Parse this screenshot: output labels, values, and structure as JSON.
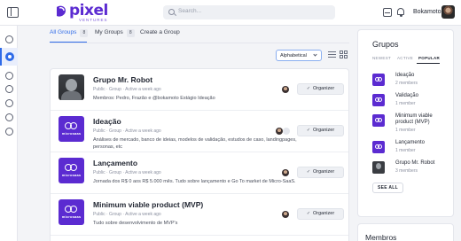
{
  "header": {
    "logo_word": "pixel",
    "logo_sub": "VENTURES",
    "search_placeholder": "Search...",
    "username": "Bokamoto",
    "brand_color": "#5b2bd1",
    "accent_color": "#2f6be8"
  },
  "sidebar": {
    "icons": [
      "panel-toggle-icon",
      "home-icon",
      "groups-icon",
      "compass-icon",
      "user-icon",
      "contacts-icon",
      "chat-icon",
      "settings-icon"
    ]
  },
  "tabs": [
    {
      "label": "All Groups",
      "count": "8"
    },
    {
      "label": "My Groups",
      "count": "8"
    },
    {
      "label": "Create a Group",
      "count": ""
    }
  ],
  "toolbar": {
    "sort_value": "Alphabetical"
  },
  "groups": [
    {
      "title": "Grupo Mr. Robot",
      "meta": "Public · Group · Active a week ago",
      "desc": "Membros: Pedro, Frazão e @bokamoto Estágio Ideação",
      "button": "Organizer"
    },
    {
      "title": "Ideação",
      "meta": "Public · Group · Active a week ago",
      "desc": "Análises de mercado, banco de ideias, modelos de validação, estudos de caso, landingpages, personas, etc",
      "button": "Organizer"
    },
    {
      "title": "Lançamento",
      "meta": "Public · Group · Active a week ago",
      "desc": "Jornada dos R$ 0 aos R$ 5.000 mês. Tudo sobre lançamento e Go To market de Micro-SaaS.",
      "button": "Organizer"
    },
    {
      "title": "Minimum viable product (MVP)",
      "meta": "Public · Group · Active a week ago",
      "desc": "Tudo sobre desenvolvimento de MVP's",
      "button": "Organizer"
    }
  ],
  "thumb_word": "microsaas",
  "panel": {
    "title": "Grupos",
    "tabs": [
      "NEWEST",
      "ACTIVE",
      "POPULAR"
    ],
    "items": [
      {
        "name": "Ideação",
        "count": "2 members"
      },
      {
        "name": "Validação",
        "count": "1 member"
      },
      {
        "name": "Minimum viable product (MVP)",
        "count": "1 member"
      },
      {
        "name": "Lançamento",
        "count": "1 member"
      },
      {
        "name": "Grupo Mr. Robot",
        "count": "3 members"
      }
    ],
    "see_all": "SEE ALL"
  },
  "panel2": {
    "title": "Membros"
  }
}
